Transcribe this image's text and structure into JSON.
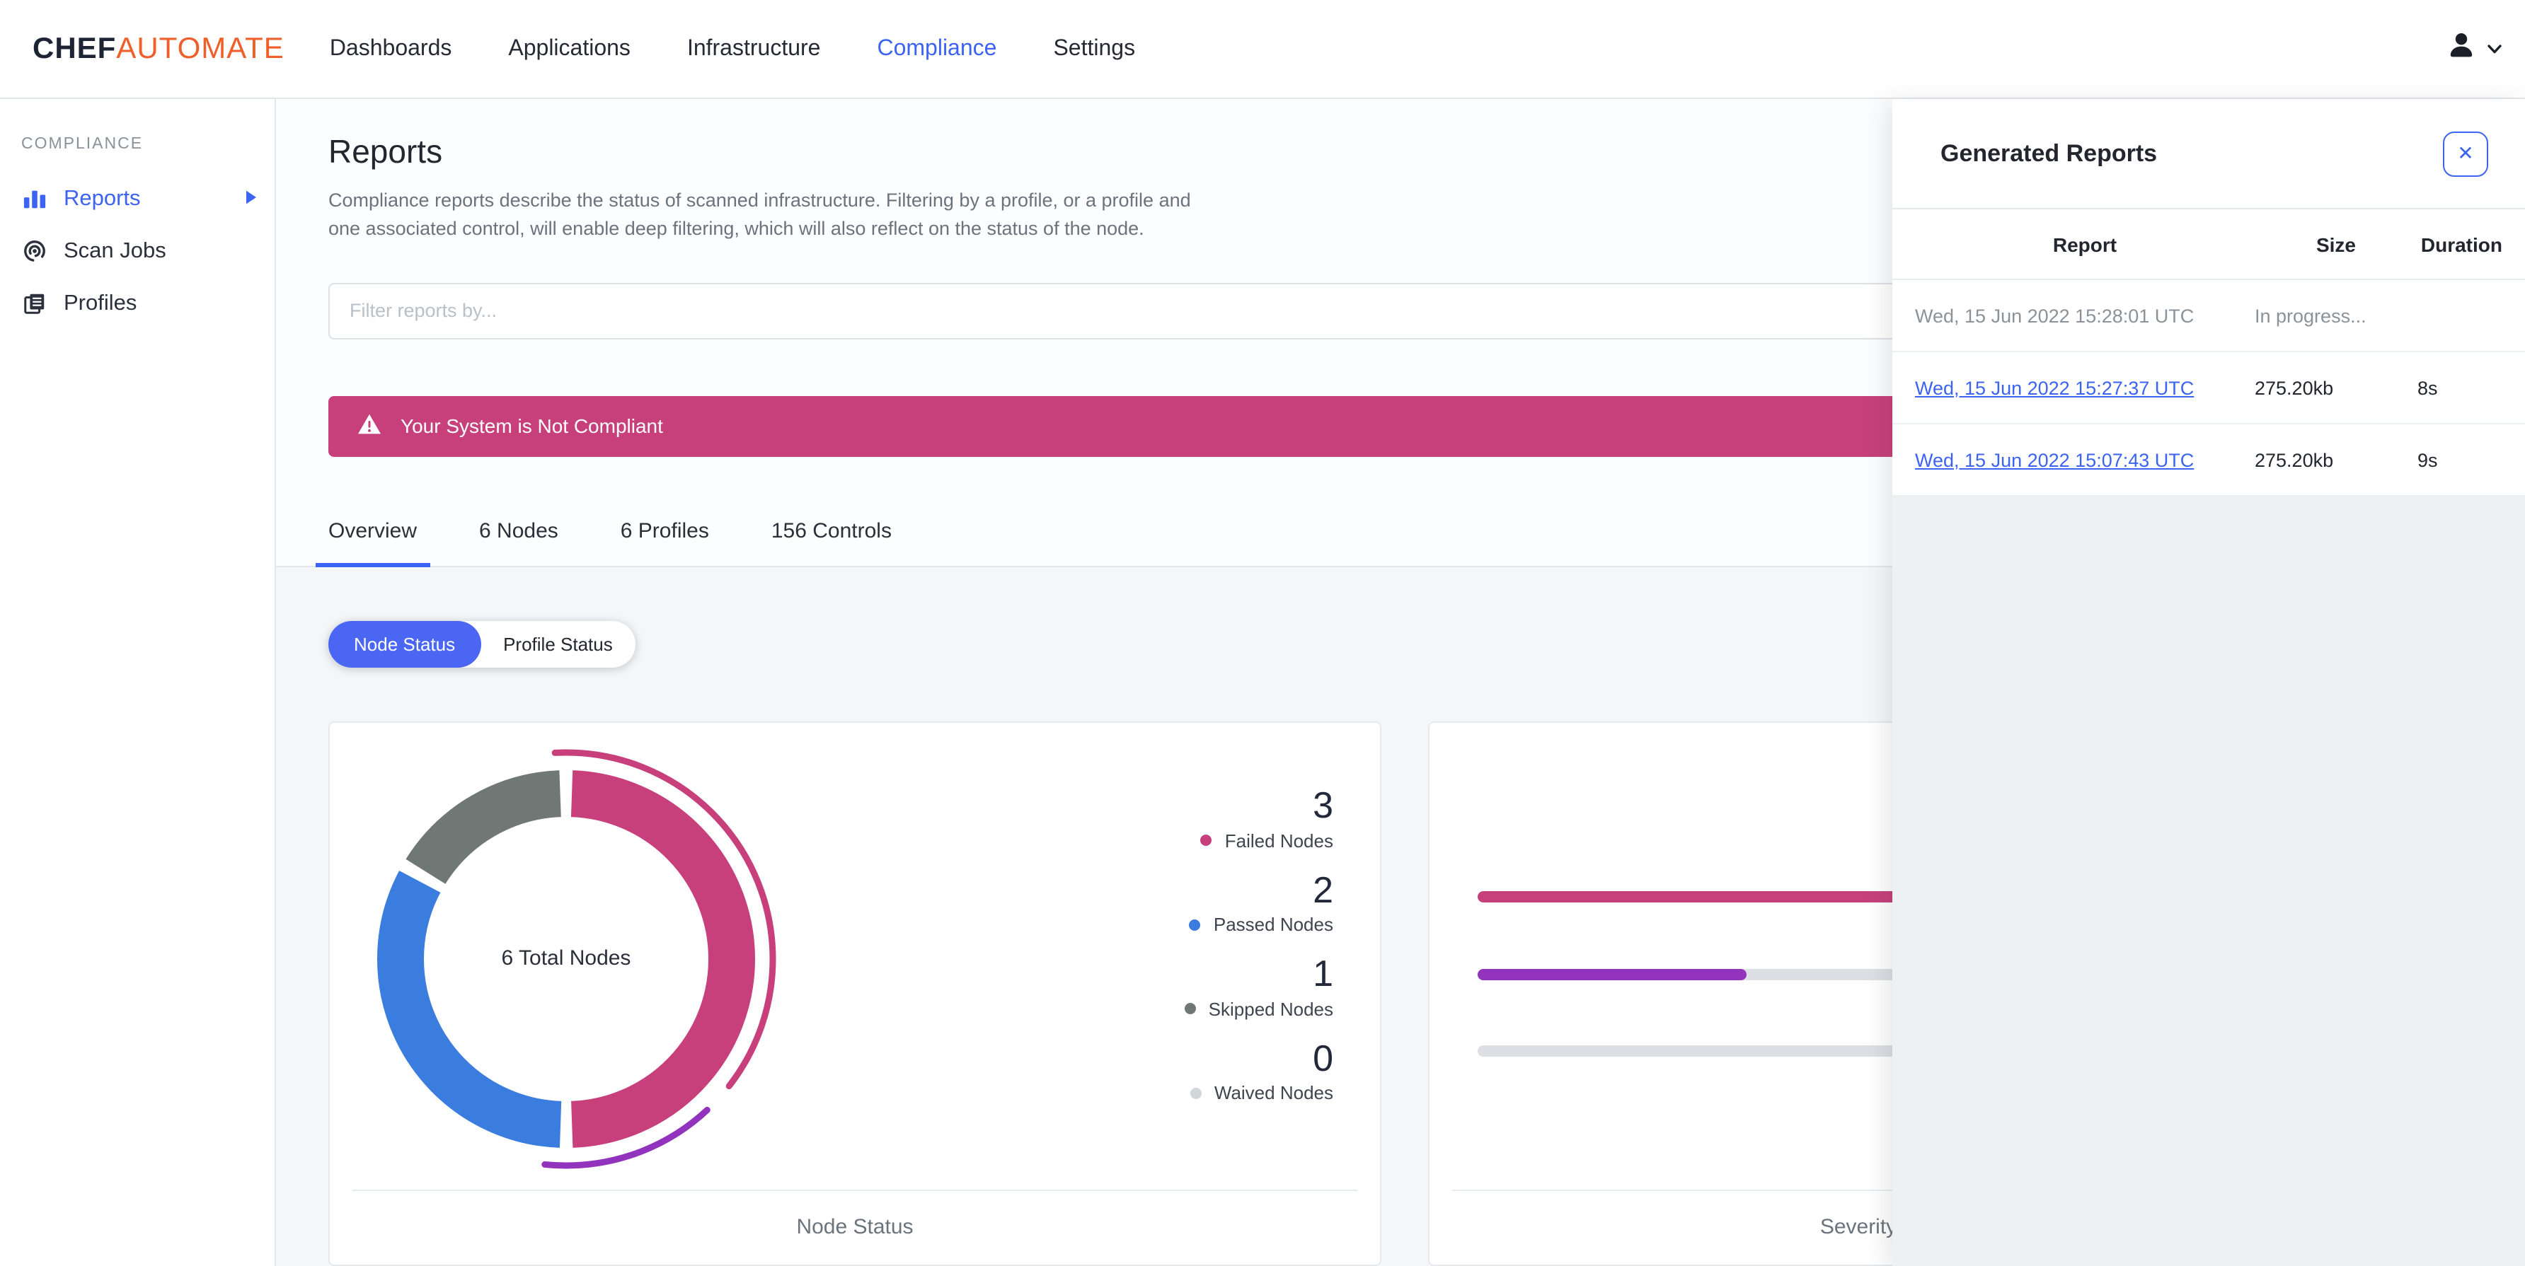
{
  "brand": {
    "chef": "CHEF",
    "automate": "AUTOMATE"
  },
  "nav": {
    "items": [
      {
        "label": "Dashboards"
      },
      {
        "label": "Applications"
      },
      {
        "label": "Infrastructure"
      },
      {
        "label": "Compliance"
      },
      {
        "label": "Settings"
      }
    ],
    "active": "Compliance"
  },
  "sidebar": {
    "section": "COMPLIANCE",
    "items": [
      {
        "label": "Reports"
      },
      {
        "label": "Scan Jobs"
      },
      {
        "label": "Profiles"
      }
    ],
    "active": "Reports"
  },
  "page": {
    "title": "Reports",
    "description": "Compliance reports describe the status of scanned infrastructure. Filtering by a profile, or a profile and one associated control, will enable deep filtering, which will also reflect on the status of the node.",
    "filter_placeholder": "Filter reports by...",
    "banner_text": "Your System is Not Compliant"
  },
  "tabs": [
    {
      "label": "Overview"
    },
    {
      "label": "6 Nodes"
    },
    {
      "label": "6 Profiles"
    },
    {
      "label": "156 Controls"
    }
  ],
  "active_tab": "Overview",
  "toggle": {
    "options": [
      "Node Status",
      "Profile Status"
    ],
    "active": "Node Status"
  },
  "colors": {
    "accent_blue": "#3c63f1",
    "toggle_blue": "#4a66f2",
    "pink": "#c7407c",
    "purple": "#9233be",
    "donut_blue": "#3b7dde",
    "gray_segment": "#6f7874",
    "waived_gray": "#cfd7da"
  },
  "chart_data": [
    {
      "type": "pie",
      "title": "Node Status",
      "center_label": "6 Total Nodes",
      "total": 6,
      "slices": [
        {
          "label": "Failed Nodes",
          "value": 3,
          "color": "#c7407c"
        },
        {
          "label": "Passed Nodes",
          "value": 2,
          "color": "#3b7dde"
        },
        {
          "label": "Skipped Nodes",
          "value": 1,
          "color": "#6f7874"
        },
        {
          "label": "Waived Nodes",
          "value": 0,
          "color": "#cfd7da"
        }
      ],
      "legend_position": "right"
    },
    {
      "type": "bar",
      "orientation": "horizontal",
      "caption": "Severity",
      "bars": [
        {
          "color": "#c7407c",
          "fraction": 1.0
        },
        {
          "color": "#9233be",
          "fraction": 0.35
        },
        {
          "color": "#dcdfe3",
          "fraction": 0.0
        }
      ]
    }
  ],
  "node_status": {
    "center_label": "6 Total Nodes",
    "caption": "Node Status",
    "legend": [
      {
        "value": "3",
        "label": "Failed Nodes"
      },
      {
        "value": "2",
        "label": "Passed Nodes"
      },
      {
        "value": "1",
        "label": "Skipped Nodes"
      },
      {
        "value": "0",
        "label": "Waived Nodes"
      }
    ]
  },
  "severity": {
    "caption": "Severity"
  },
  "generated_reports": {
    "title": "Generated Reports",
    "close_label": "✕",
    "columns": {
      "report": "Report",
      "size": "Size",
      "duration": "Duration"
    },
    "rows": [
      {
        "report": "Wed, 15 Jun 2022 15:28:01 UTC",
        "size": "In progress...",
        "duration": "",
        "is_link": false
      },
      {
        "report": "Wed, 15 Jun 2022 15:27:37 UTC",
        "size": "275.20kb",
        "duration": "8s",
        "is_link": true
      },
      {
        "report": "Wed, 15 Jun 2022 15:07:43 UTC",
        "size": "275.20kb",
        "duration": "9s",
        "is_link": true
      }
    ]
  }
}
